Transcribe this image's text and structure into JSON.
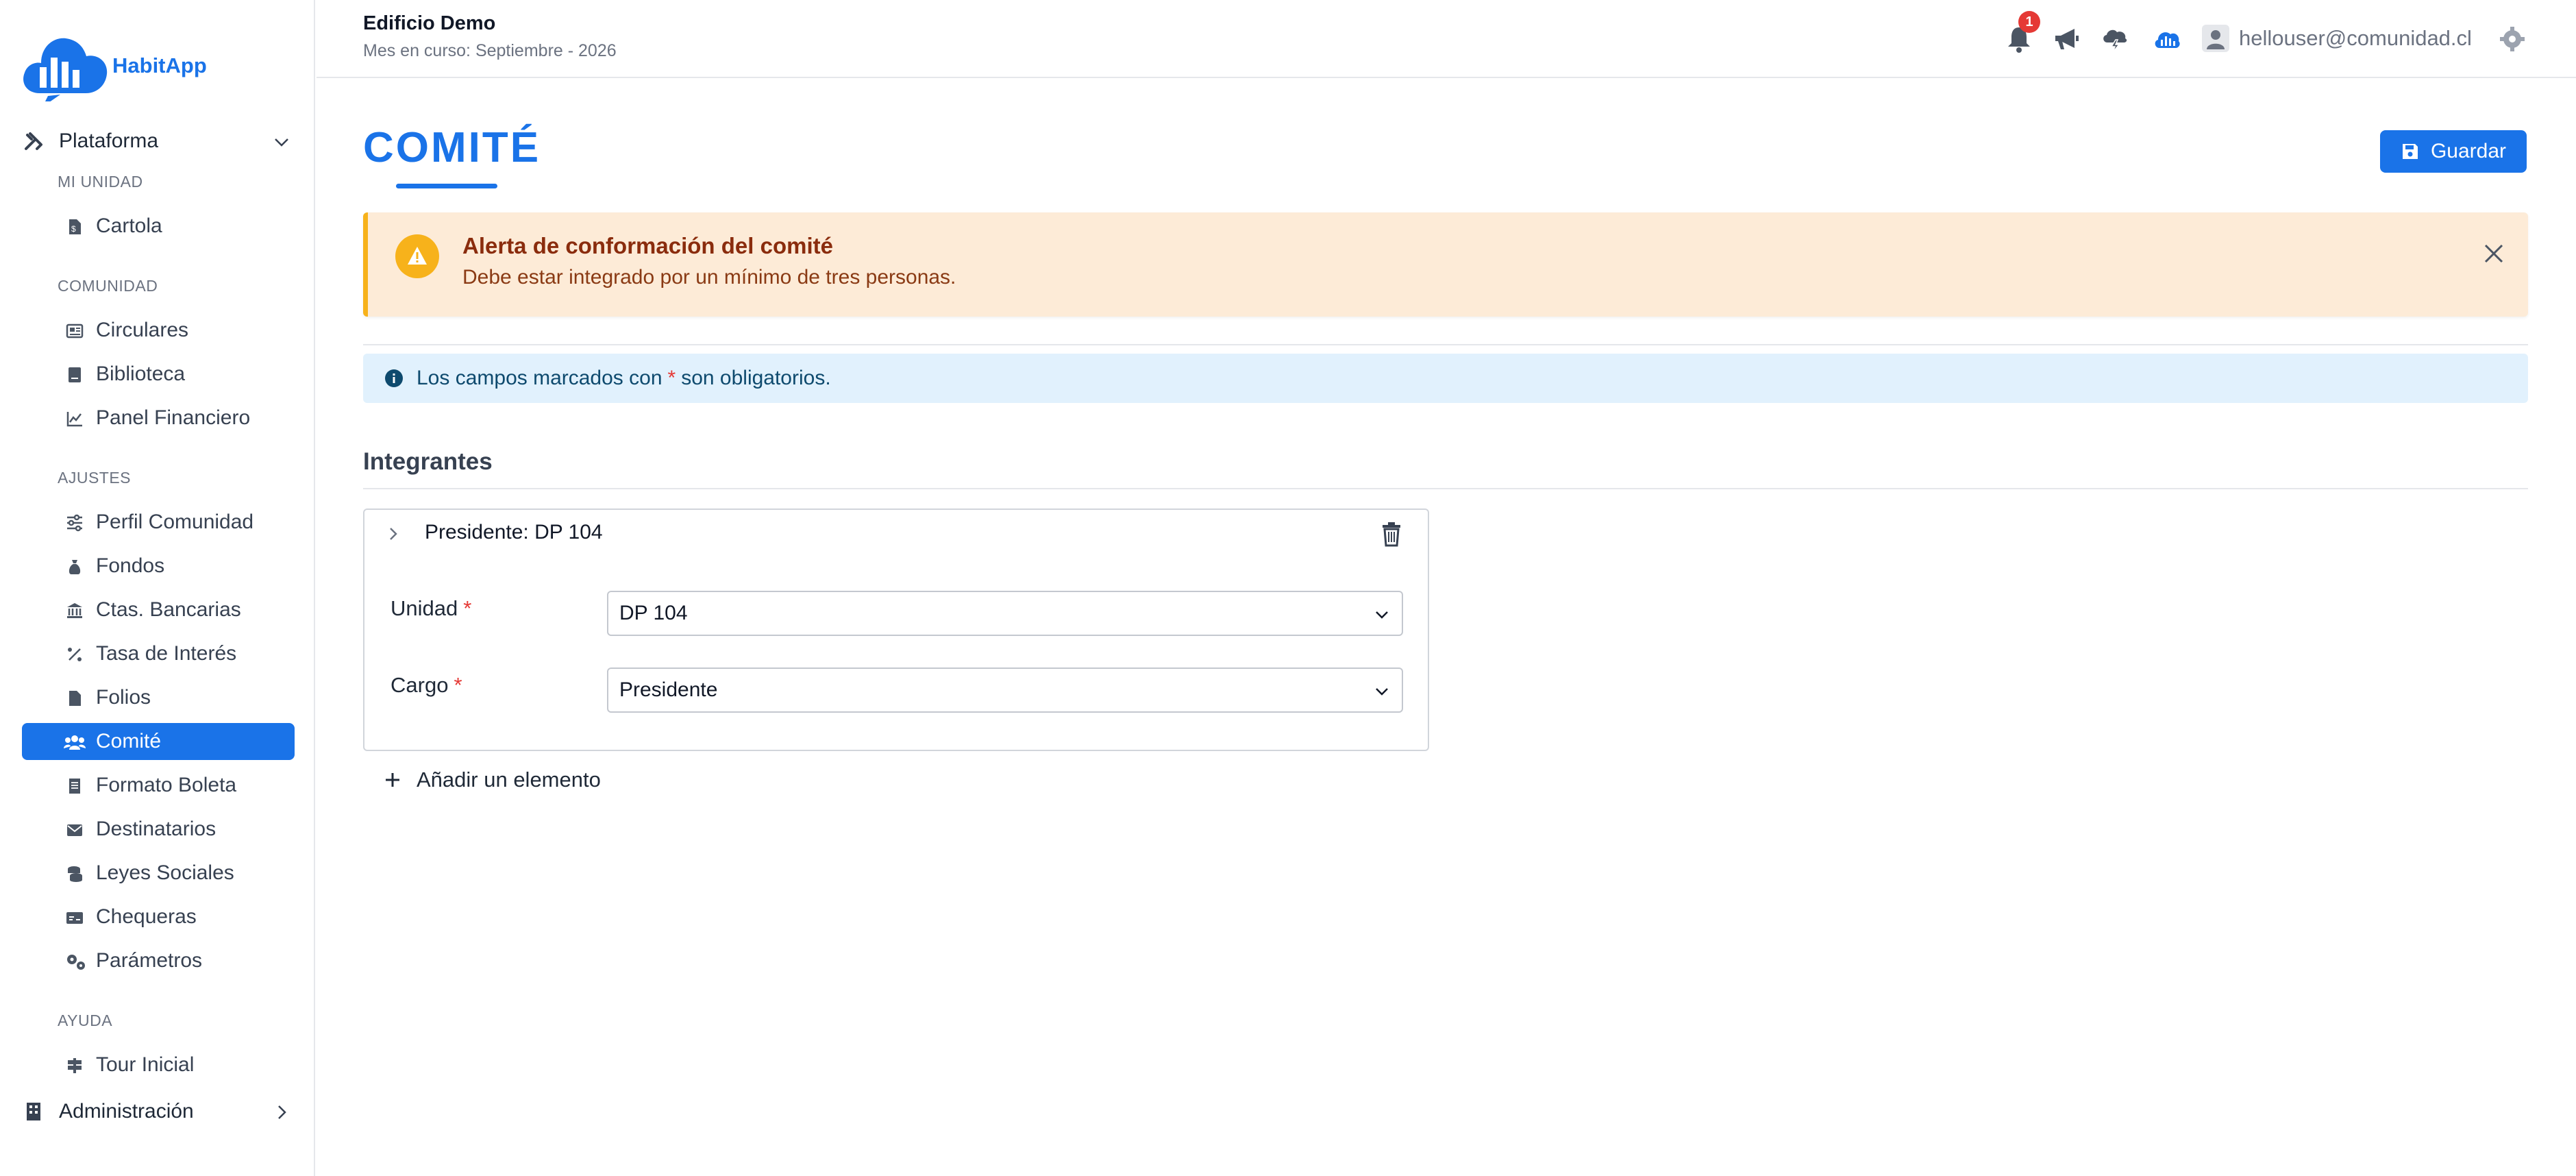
{
  "app": {
    "logo_text": "HabitApp"
  },
  "header": {
    "building": "Edificio Demo",
    "period": "Mes en curso: Septiembre - 2026",
    "notification_count": "1",
    "user_email": "hellouser@comunidad.cl"
  },
  "sidebar": {
    "group_platform": "Plataforma",
    "section_mi_unidad": "MI UNIDAD",
    "cartola": "Cartola",
    "section_comunidad": "COMUNIDAD",
    "circulares": "Circulares",
    "biblioteca": "Biblioteca",
    "panel_financiero": "Panel Financiero",
    "section_ajustes": "AJUSTES",
    "perfil_comunidad": "Perfil Comunidad",
    "fondos": "Fondos",
    "ctas_bancarias": "Ctas. Bancarias",
    "tasa_interes": "Tasa de Interés",
    "folios": "Folios",
    "comite": "Comité",
    "formato_boleta": "Formato Boleta",
    "destinatarios": "Destinatarios",
    "leyes_sociales": "Leyes Sociales",
    "chequeras": "Chequeras",
    "parametros": "Parámetros",
    "section_ayuda": "AYUDA",
    "tour_inicial": "Tour Inicial",
    "group_admin": "Administración"
  },
  "main": {
    "title": "COMITÉ",
    "save_label": "Guardar",
    "alert": {
      "title": "Alerta de conformación del comité",
      "text": "Debe estar integrado por un mínimo de tres personas."
    },
    "info": {
      "prefix": "Los campos marcados con",
      "asterisk": "*",
      "suffix": "son obligatorios."
    },
    "section_title": "Integrantes",
    "member": {
      "title": "Presidente: DP 104",
      "unidad_label": "Unidad",
      "unidad_value": "DP 104",
      "cargo_label": "Cargo",
      "cargo_value": "Presidente",
      "required_mark": "*"
    },
    "add_element": "Añadir un elemento"
  },
  "colors": {
    "primary": "#1a73e8",
    "warning": "#f7b21b",
    "warning_bg": "#fdebd7",
    "info_bg": "#e1f1fd",
    "danger": "#e53935"
  }
}
